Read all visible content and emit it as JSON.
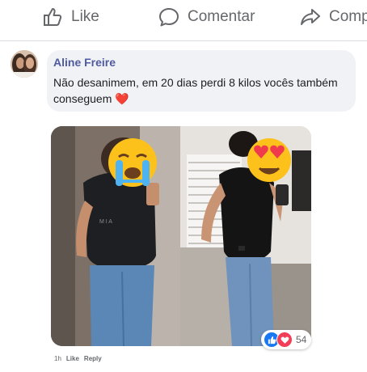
{
  "actions": {
    "like_label": "Like",
    "comment_label": "Comentar",
    "share_label": "Comp"
  },
  "comment": {
    "author": "Aline Freire",
    "text": "Não desanimem, em 20 dias perdi 8 kilos vocês também conseguem",
    "emoji": "❤️"
  },
  "reactions": {
    "icons": [
      "like-icon",
      "love-icon"
    ],
    "count": "54"
  },
  "meta": {
    "time": "1h",
    "like_link": "Like",
    "reply_link": "Reply"
  },
  "colors": {
    "author": "#4f5aa0",
    "like_blue": "#1877f2",
    "love_red": "#f33e58"
  }
}
